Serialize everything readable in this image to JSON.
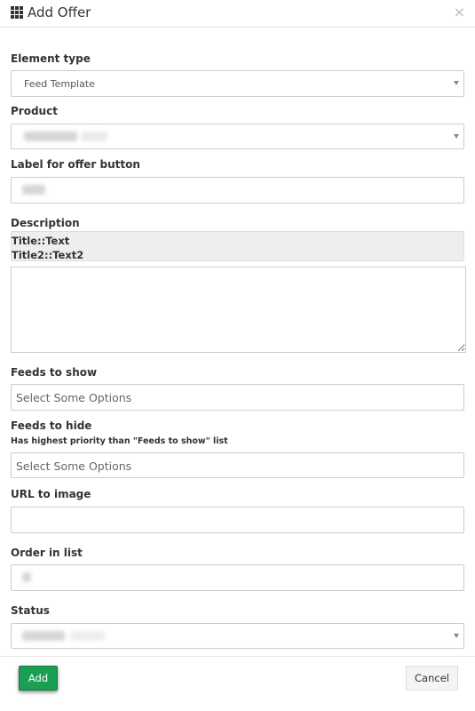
{
  "header": {
    "icon": "grid-icon",
    "title": "Add Offer",
    "close_glyph": "×"
  },
  "form": {
    "element_type": {
      "label": "Element type",
      "value": "Feed Template"
    },
    "product": {
      "label": "Product"
    },
    "offer_button_label": {
      "label": "Label for offer button"
    },
    "description": {
      "label": "Description",
      "hint_lines": [
        "Title::Text",
        "Title2::Text2"
      ]
    },
    "feeds_to_show": {
      "label": "Feeds to show",
      "placeholder": "Select Some Options"
    },
    "feeds_to_hide": {
      "label": "Feeds to hide",
      "note": "Has highest priority than \"Feeds to show\" list",
      "placeholder": "Select Some Options"
    },
    "url_to_image": {
      "label": "URL to image"
    },
    "order_in_list": {
      "label": "Order in list"
    },
    "status": {
      "label": "Status"
    }
  },
  "footer": {
    "add_label": "Add",
    "cancel_label": "Cancel"
  }
}
